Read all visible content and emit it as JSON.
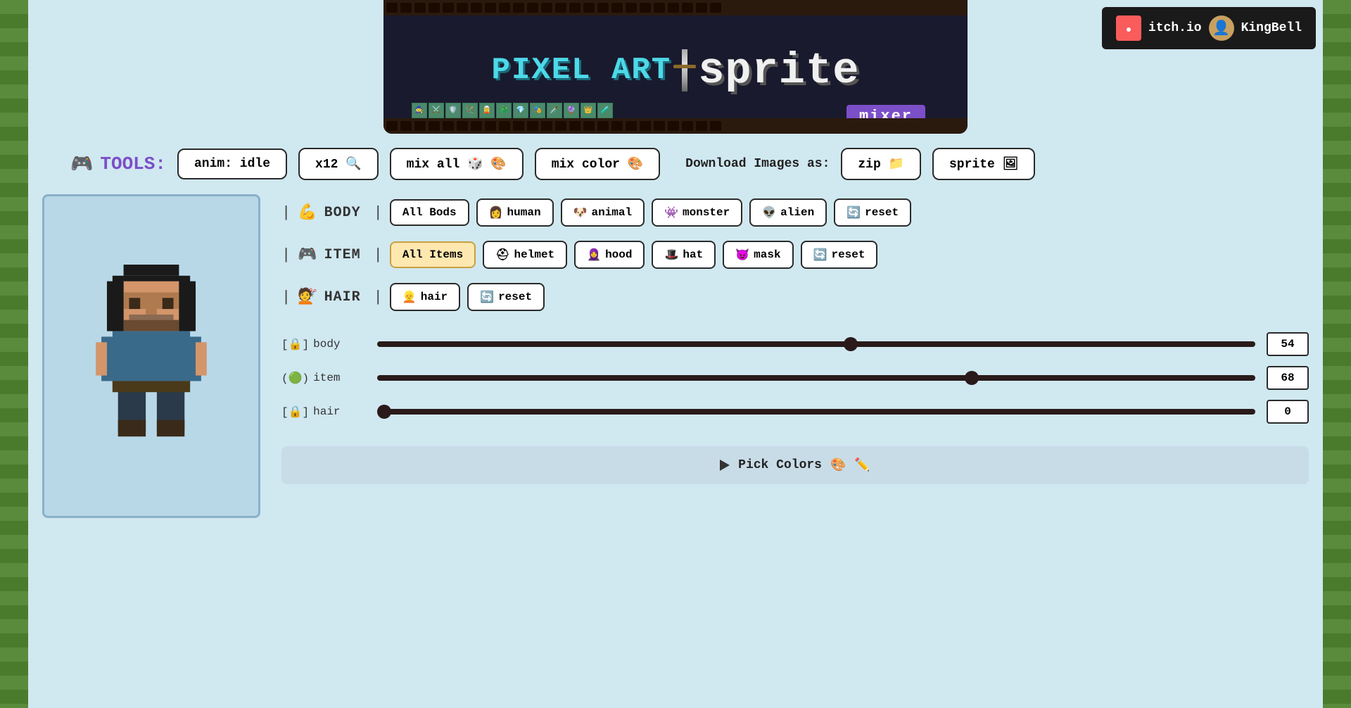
{
  "app": {
    "title": "Pixel Art Sprite Mixer"
  },
  "header": {
    "pixel_art_label": "PIXEL ART",
    "sprite_label": "sprite",
    "mixer_label": "mixer",
    "itch_label": "itch.io",
    "user_label": "KingBell"
  },
  "tools": {
    "label": "TOOLS:",
    "buttons": [
      {
        "id": "anim",
        "label": "anim: idle",
        "icon": ""
      },
      {
        "id": "zoom",
        "label": "x12 🔍",
        "icon": ""
      },
      {
        "id": "mix_all",
        "label": "mix all 🎨",
        "icon": ""
      },
      {
        "id": "mix_color",
        "label": "mix color 🎨",
        "icon": ""
      }
    ],
    "download_label": "Download Images as:",
    "download_buttons": [
      {
        "id": "zip",
        "label": "zip 📁"
      },
      {
        "id": "sprite",
        "label": "sprite 🖼"
      }
    ]
  },
  "selectors": {
    "body": {
      "label": "BODY",
      "icon": "💪",
      "buttons": [
        {
          "id": "all_bods",
          "label": "All Bods",
          "active": false
        },
        {
          "id": "human",
          "label": "human",
          "icon": "👩",
          "active": false
        },
        {
          "id": "animal",
          "label": "animal",
          "icon": "🐶",
          "active": false
        },
        {
          "id": "monster",
          "label": "monster",
          "icon": "👾",
          "active": false
        },
        {
          "id": "alien",
          "label": "alien",
          "icon": "👽",
          "active": false
        },
        {
          "id": "reset",
          "label": "reset",
          "icon": "🔄",
          "active": false
        }
      ]
    },
    "item": {
      "label": "ITEM",
      "icon": "🎮",
      "buttons": [
        {
          "id": "all_items",
          "label": "All Items",
          "active": true
        },
        {
          "id": "helmet",
          "label": "helmet",
          "icon": "⛑",
          "active": false
        },
        {
          "id": "hood",
          "label": "hood",
          "icon": "🧕",
          "active": false
        },
        {
          "id": "hat",
          "label": "hat",
          "icon": "🎩",
          "active": false
        },
        {
          "id": "mask",
          "label": "mask",
          "icon": "😈",
          "active": false
        },
        {
          "id": "reset",
          "label": "reset",
          "icon": "🔄",
          "active": false
        }
      ]
    },
    "hair": {
      "label": "HAIR",
      "icon": "💇",
      "buttons": [
        {
          "id": "hair",
          "label": "hair",
          "icon": "👱",
          "active": false
        },
        {
          "id": "reset",
          "label": "reset",
          "icon": "🔄",
          "active": false
        }
      ]
    }
  },
  "sliders": [
    {
      "id": "body",
      "label": "body",
      "prefix_left": "[🔒]",
      "value": 54,
      "max": 100,
      "percent": 54,
      "indicator_color": "#2a1a1a"
    },
    {
      "id": "item",
      "label": "item",
      "prefix_left": "(🟢)",
      "value": 68,
      "max": 100,
      "percent": 68,
      "indicator_color": "#2a1a1a"
    },
    {
      "id": "hair",
      "label": "hair",
      "prefix_left": "[🔒]",
      "value": 0,
      "max": 100,
      "percent": 0,
      "indicator_color": "#2a1a1a"
    }
  ],
  "pick_colors": {
    "label": "Pick Colors",
    "icon_palette": "🎨",
    "icon_pen": "✏️"
  },
  "colors": {
    "bg": "#d0e8f0",
    "accent_purple": "#7b4fc8",
    "border_dark": "#2a2a2a",
    "active_btn_bg": "#ffe8b0",
    "active_btn_border": "#c8a040",
    "panel_bg": "#c8dce8",
    "char_bg": "#b8d8e8"
  }
}
